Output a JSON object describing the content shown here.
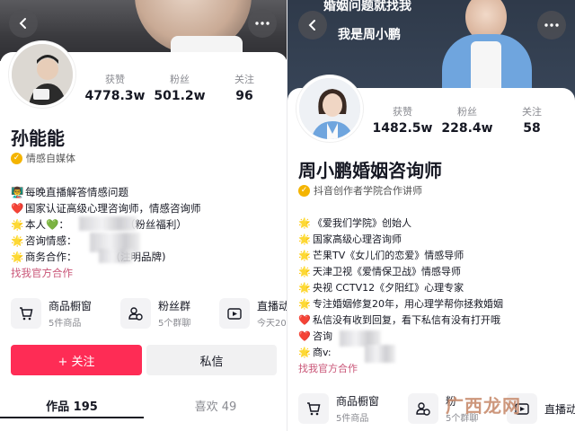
{
  "left": {
    "name": "孙能能",
    "badge": "情感自媒体",
    "stats": [
      {
        "label": "获赞",
        "value": "4778.3w"
      },
      {
        "label": "粉丝",
        "value": "501.2w"
      },
      {
        "label": "关注",
        "value": "96"
      }
    ],
    "bio": [
      {
        "emoji": "👨‍🏫",
        "text": "每晚直播解答情感问题"
      },
      {
        "emoji": "❤️",
        "text": "国家认证高级心理咨询师，情感咨询师"
      },
      {
        "emoji": "🌟",
        "text": "本人💚：",
        "suffix": "（粉丝福利）"
      },
      {
        "emoji": "🌟",
        "text": "咨询情感："
      },
      {
        "emoji": "🌟",
        "text": "商务合作：",
        "suffix": "(注明品牌)"
      }
    ],
    "contact_link": "找我官方合作",
    "services": [
      {
        "title": "商品橱窗",
        "sub": "5件商品",
        "icon": "cart-icon"
      },
      {
        "title": "粉丝群",
        "sub": "5个群聊",
        "icon": "fan-group-icon"
      },
      {
        "title": "直播动",
        "sub": "今天20",
        "icon": "live-icon"
      }
    ],
    "follow_label": "+ 关注",
    "message_label": "私信",
    "tabs": [
      {
        "label": "作品 195",
        "active": true
      },
      {
        "label": "喜欢 49",
        "active": false
      }
    ]
  },
  "right": {
    "banner_line1": "婚姻问题就找我",
    "banner_line2": "我是周小鹏",
    "name": "周小鹏婚姻咨询师",
    "badge": "抖音创作者学院合作讲师",
    "stats": [
      {
        "label": "获赞",
        "value": "1482.5w"
      },
      {
        "label": "粉丝",
        "value": "228.4w"
      },
      {
        "label": "关注",
        "value": "58"
      }
    ],
    "bio": [
      {
        "emoji": "🌟",
        "text": "《爱我们学院》创始人"
      },
      {
        "emoji": "🌟",
        "text": "国家高级心理咨询师"
      },
      {
        "emoji": "🌟",
        "text": "芒果TV《女儿们的恋爱》情感导师"
      },
      {
        "emoji": "🌟",
        "text": "天津卫视《爱情保卫战》情感导师"
      },
      {
        "emoji": "🌟",
        "text": "央视 CCTV12《夕阳红》心理专家"
      },
      {
        "emoji": "🌟",
        "text": "专注婚姻修复20年，用心理学帮你拯救婚姻"
      },
      {
        "emoji": "❤️",
        "text": "私信没有收到回复，看下私信有没有打开哦"
      },
      {
        "emoji": "❤️",
        "text": "咨询"
      },
      {
        "emoji": "🌟",
        "text": "商v:"
      }
    ],
    "contact_link": "找我官方合作",
    "services": [
      {
        "title": "商品橱窗",
        "sub": "5件商品",
        "icon": "cart-icon"
      },
      {
        "title": "粉",
        "sub": "5个群聊",
        "icon": "fan-group-icon"
      },
      {
        "title": "直播动",
        "sub": "",
        "icon": "live-icon"
      }
    ],
    "watermark": "广西龙网"
  },
  "colors": {
    "follow": "#fe2c55",
    "badge": "#f4b400",
    "link": "#c95577"
  }
}
